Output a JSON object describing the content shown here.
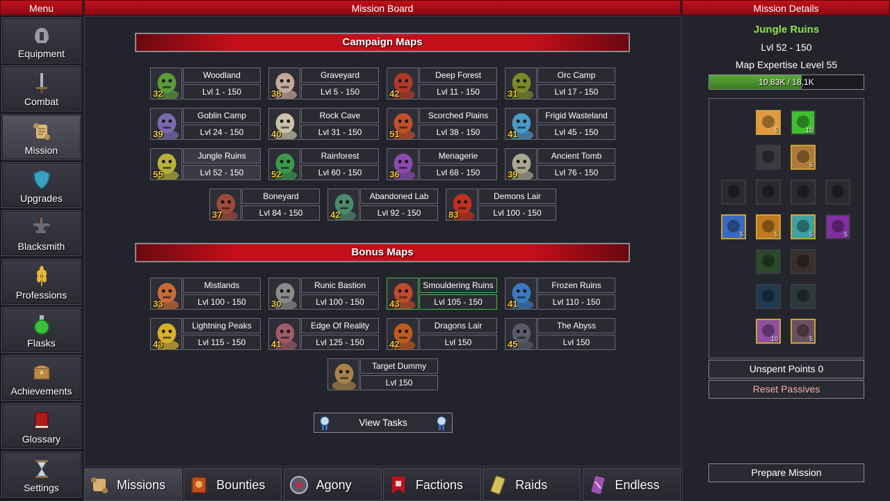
{
  "headers": {
    "menu": "Menu",
    "board": "Mission Board",
    "details": "Mission Details"
  },
  "menu": [
    {
      "label": "Equipment",
      "icon": "helmet-icon"
    },
    {
      "label": "Combat",
      "icon": "sword-icon"
    },
    {
      "label": "Mission",
      "icon": "scroll-icon",
      "active": true
    },
    {
      "label": "Upgrades",
      "icon": "shield-icon"
    },
    {
      "label": "Blacksmith",
      "icon": "anvil-icon"
    },
    {
      "label": "Professions",
      "icon": "wheat-icon"
    },
    {
      "label": "Flasks",
      "icon": "flask-icon"
    },
    {
      "label": "Achievements",
      "icon": "chest-icon"
    },
    {
      "label": "Glossary",
      "icon": "book-icon"
    },
    {
      "label": "Settings",
      "icon": "hourglass-icon"
    }
  ],
  "campaign": {
    "title": "Campaign Maps",
    "maps": [
      {
        "name": "Woodland",
        "range": "Lvl 1 - 150",
        "badge": "32",
        "color": "#5a9a3a"
      },
      {
        "name": "Graveyard",
        "range": "Lvl 5 - 150",
        "badge": "38",
        "color": "#c4a89a"
      },
      {
        "name": "Deep Forest",
        "range": "Lvl 11 - 150",
        "badge": "42",
        "color": "#b03a2a"
      },
      {
        "name": "Orc Camp",
        "range": "Lvl 17 - 150",
        "badge": "31",
        "color": "#7a8a2a"
      },
      {
        "name": "Goblin Camp",
        "range": "Lvl 24 - 150",
        "badge": "39",
        "color": "#7a6ab0"
      },
      {
        "name": "Rock Cave",
        "range": "Lvl 31 - 150",
        "badge": "40",
        "color": "#c8c0a8"
      },
      {
        "name": "Scorched Plains",
        "range": "Lvl 38 - 150",
        "badge": "51",
        "color": "#c0502a"
      },
      {
        "name": "Frigid Wasteland",
        "range": "Lvl 45 - 150",
        "badge": "41",
        "color": "#4a9ac8"
      },
      {
        "name": "Jungle Ruins",
        "range": "Lvl 52 - 150",
        "badge": "55",
        "color": "#b8b03a",
        "selected": true
      },
      {
        "name": "Rainforest",
        "range": "Lvl 60 - 150",
        "badge": "52",
        "color": "#3a9a4a"
      },
      {
        "name": "Menagerie",
        "range": "Lvl 68 - 150",
        "badge": "36",
        "color": "#8a4ab0"
      },
      {
        "name": "Ancient Tomb",
        "range": "Lvl 76 - 150",
        "badge": "39",
        "color": "#a8a890"
      },
      {
        "name": "Boneyard",
        "range": "Lvl 84 - 150",
        "badge": "37",
        "color": "#a04a3a"
      },
      {
        "name": "Abandoned Lab",
        "range": "Lvl 92 - 150",
        "badge": "42",
        "color": "#4a8a6a"
      },
      {
        "name": "Demons Lair",
        "range": "Lvl 100 - 150",
        "badge": "83",
        "color": "#c0301a"
      }
    ]
  },
  "bonus": {
    "title": "Bonus Maps",
    "maps": [
      {
        "name": "Mistlands",
        "range": "Lvl 100 - 150",
        "badge": "33",
        "color": "#c86a3a"
      },
      {
        "name": "Runic Bastion",
        "range": "Lvl 100 - 150",
        "badge": "30",
        "color": "#8a8a8a"
      },
      {
        "name": "Smouldering Ruins",
        "range": "Lvl 105 - 150",
        "badge": "43",
        "color": "#c04a2a",
        "highlight": true
      },
      {
        "name": "Frozen Ruins",
        "range": "Lvl 110 - 150",
        "badge": "41",
        "color": "#3a7ac0"
      },
      {
        "name": "Lightning Peaks",
        "range": "Lvl 115 - 150",
        "badge": "43",
        "color": "#d8b02a"
      },
      {
        "name": "Edge Of Reality",
        "range": "Lvl 125 - 150",
        "badge": "41",
        "color": "#a05a6a"
      },
      {
        "name": "Dragons Lair",
        "range": "Lvl 150",
        "badge": "42",
        "color": "#c05a1a"
      },
      {
        "name": "The Abyss",
        "range": "Lvl 150",
        "badge": "45",
        "color": "#5a5a6a"
      },
      {
        "name": "Target Dummy",
        "range": "Lvl 150",
        "badge": "",
        "color": "#a8824a"
      }
    ]
  },
  "view_tasks": "View Tasks",
  "tabs": [
    {
      "label": "Missions",
      "icon": "scroll-icon",
      "color": "#d8b070",
      "active": true
    },
    {
      "label": "Bounties",
      "icon": "bounty-icon",
      "color": "#c0501a"
    },
    {
      "label": "Agony",
      "icon": "agony-icon",
      "color": "#b8b8c8"
    },
    {
      "label": "Factions",
      "icon": "banner-icon",
      "color": "#c0101a"
    },
    {
      "label": "Raids",
      "icon": "raid-icon",
      "color": "#d8c060"
    },
    {
      "label": "Endless",
      "icon": "endless-icon",
      "color": "#a050b0"
    }
  ],
  "details": {
    "title": "Jungle Ruins",
    "level": "Lvl 52 - 150",
    "expertise": "Map Expertise Level 55",
    "progress_text": "10,83K / 18,1K",
    "progress": 0.598,
    "unspent": "Unspent Points 0",
    "reset": "Reset Passives",
    "prepare": "Prepare Mission",
    "passives": [
      {
        "icon": "wolf-icon",
        "count": "5",
        "color": "#e09a40",
        "gold": true
      },
      {
        "icon": "burst-icon",
        "count": "10",
        "color": "#40c030",
        "gold": false
      },
      {
        "icon": "chest-icon",
        "count": "",
        "color": "#3a3a40",
        "gold": false
      },
      {
        "icon": "chest-icon",
        "count": "5",
        "color": "#b07a3a",
        "gold": true
      },
      {
        "icon": "demon-icon",
        "count": "",
        "color": "#2a2a30",
        "gold": false
      },
      {
        "icon": "bull-icon",
        "count": "",
        "color": "#2a2a30",
        "gold": false
      },
      {
        "icon": "ghost-icon",
        "count": "",
        "color": "#2a2a30",
        "gold": false
      },
      {
        "icon": "void-icon",
        "count": "",
        "color": "#2a2a30",
        "gold": false
      },
      {
        "icon": "demon-icon",
        "count": "5",
        "color": "#3a6ac0",
        "gold": true
      },
      {
        "icon": "bull-icon",
        "count": "5",
        "color": "#c07a20",
        "gold": true
      },
      {
        "icon": "ghost-icon",
        "count": "5",
        "color": "#40a0a0",
        "gold": true
      },
      {
        "icon": "void-icon",
        "count": "5",
        "color": "#8030a0",
        "gold": false
      },
      {
        "icon": "leaf-icon",
        "count": "",
        "color": "#2a4a2a",
        "gold": false
      },
      {
        "icon": "wing-icon",
        "count": "",
        "color": "#3a302a",
        "gold": false
      },
      {
        "icon": "shield-icon",
        "count": "",
        "color": "#203a50",
        "gold": false
      },
      {
        "icon": "blade-icon",
        "count": "",
        "color": "#2a3a3a",
        "gold": false
      },
      {
        "icon": "tentacle-icon",
        "count": "10",
        "color": "#9050a0",
        "gold": true
      },
      {
        "icon": "skull-icon",
        "count": "5",
        "color": "#6a5060",
        "gold": true
      }
    ]
  }
}
